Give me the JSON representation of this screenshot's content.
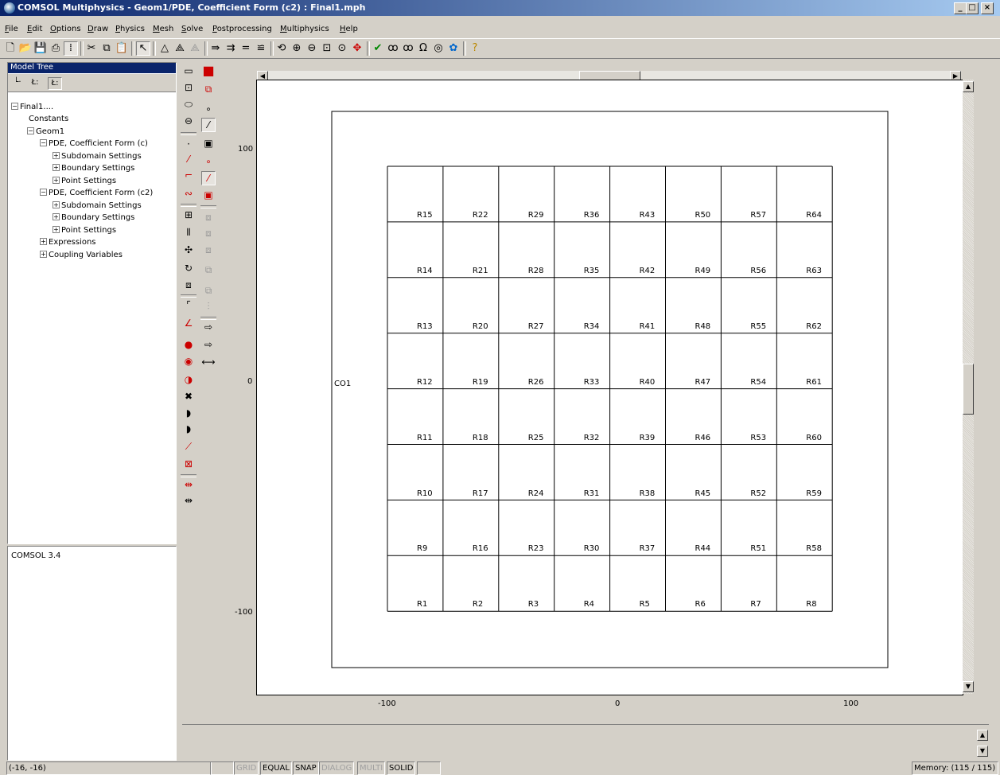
{
  "window": {
    "title": "COMSOL Multiphysics - Geom1/PDE, Coefficient Form (c2) : Final1.mph"
  },
  "menu": [
    "File",
    "Edit",
    "Options",
    "Draw",
    "Physics",
    "Mesh",
    "Solve",
    "Postprocessing",
    "Multiphysics",
    "Help"
  ],
  "model_tree": {
    "header": "Model Tree",
    "nodes": {
      "root": "Final1....",
      "constants": "Constants",
      "geom": "Geom1",
      "pde1": "PDE, Coefficient Form (c)",
      "pde1_sub": "Subdomain Settings",
      "pde1_bnd": "Boundary Settings",
      "pde1_pt": "Point Settings",
      "pde2": "PDE, Coefficient Form (c2)",
      "pde2_sub": "Subdomain Settings",
      "pde2_bnd": "Boundary Settings",
      "pde2_pt": "Point Settings",
      "expressions": "Expressions",
      "coupling": "Coupling Variables"
    }
  },
  "log": "COMSOL 3.4",
  "plot": {
    "x_ticks": [
      -100,
      0,
      100
    ],
    "y_ticks": [
      100,
      0,
      -100
    ],
    "outer_label": "CO1",
    "grid_rows": [
      [
        "R15",
        "R22",
        "R29",
        "R36",
        "R43",
        "R50",
        "R57",
        "R64"
      ],
      [
        "R14",
        "R21",
        "R28",
        "R35",
        "R42",
        "R49",
        "R56",
        "R63"
      ],
      [
        "R13",
        "R20",
        "R27",
        "R34",
        "R41",
        "R48",
        "R55",
        "R62"
      ],
      [
        "R12",
        "R19",
        "R26",
        "R33",
        "R40",
        "R47",
        "R54",
        "R61"
      ],
      [
        "R11",
        "R18",
        "R25",
        "R32",
        "R39",
        "R46",
        "R53",
        "R60"
      ],
      [
        "R10",
        "R17",
        "R24",
        "R31",
        "R38",
        "R45",
        "R52",
        "R59"
      ],
      [
        "R9",
        "R16",
        "R23",
        "R30",
        "R37",
        "R44",
        "R51",
        "R58"
      ],
      [
        "R1",
        "R2",
        "R3",
        "R4",
        "R5",
        "R6",
        "R7",
        "R8"
      ]
    ]
  },
  "status": {
    "coords": "(-16, -16)",
    "grid": "GRID",
    "equal": "EQUAL",
    "snap": "SNAP",
    "dialog": "DIALOG",
    "multi": "MULTI",
    "solid": "SOLID",
    "memory": "Memory: (115 / 115)"
  }
}
